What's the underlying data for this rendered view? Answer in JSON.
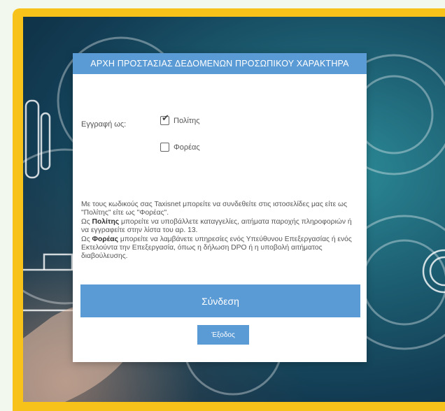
{
  "modal": {
    "title": "ΑΡΧΗ ΠΡΟΣΤΑΣΙΑΣ ΔΕΔΟΜΕΝΩΝ ΠΡΟΣΩΠΙΚΟΥ ΧΑΡΑΚΤΗΡΑ",
    "register_as_label": "Εγγραφή ως:",
    "options": [
      {
        "label": "Πολίτης",
        "checked": true
      },
      {
        "label": "Φορέας",
        "checked": false
      }
    ],
    "info": {
      "line1": "Με τους κωδικούς σας Taxisnet μπορείτε να συνδεθείτε στις ιστοσελίδες μας είτε ως \"Πολίτης\" είτε ως \"Φορέας\".",
      "citizen_prefix": "Ως",
      "citizen_word": "Πολίτης",
      "citizen_text": "μπορείτε να υποβάλλετε καταγγελίες, αιτήματα παροχής πληροφοριών ή να εγγραφείτε στην λίστα του αρ. 13.",
      "entity_prefix": "Ως",
      "entity_word": "Φορέας",
      "entity_text": "μπορείτε να λαμβάνετε υπηρεσίες ενός Υπεύθυνου Επεξεργασίας ή ενός Εκτελούντα την Επεξεργασία, όπως η δήλωση DPO ή η υποβολή αιτήματος διαβούλευσης."
    },
    "login_button": "Σύνδεση",
    "exit_button": "Έξοδος"
  },
  "colors": {
    "accent": "#5b9bd5",
    "frame": "#f7c31a"
  },
  "icons": {
    "checked": "checkbox-checked-icon",
    "unchecked": "checkbox-unchecked-icon"
  }
}
